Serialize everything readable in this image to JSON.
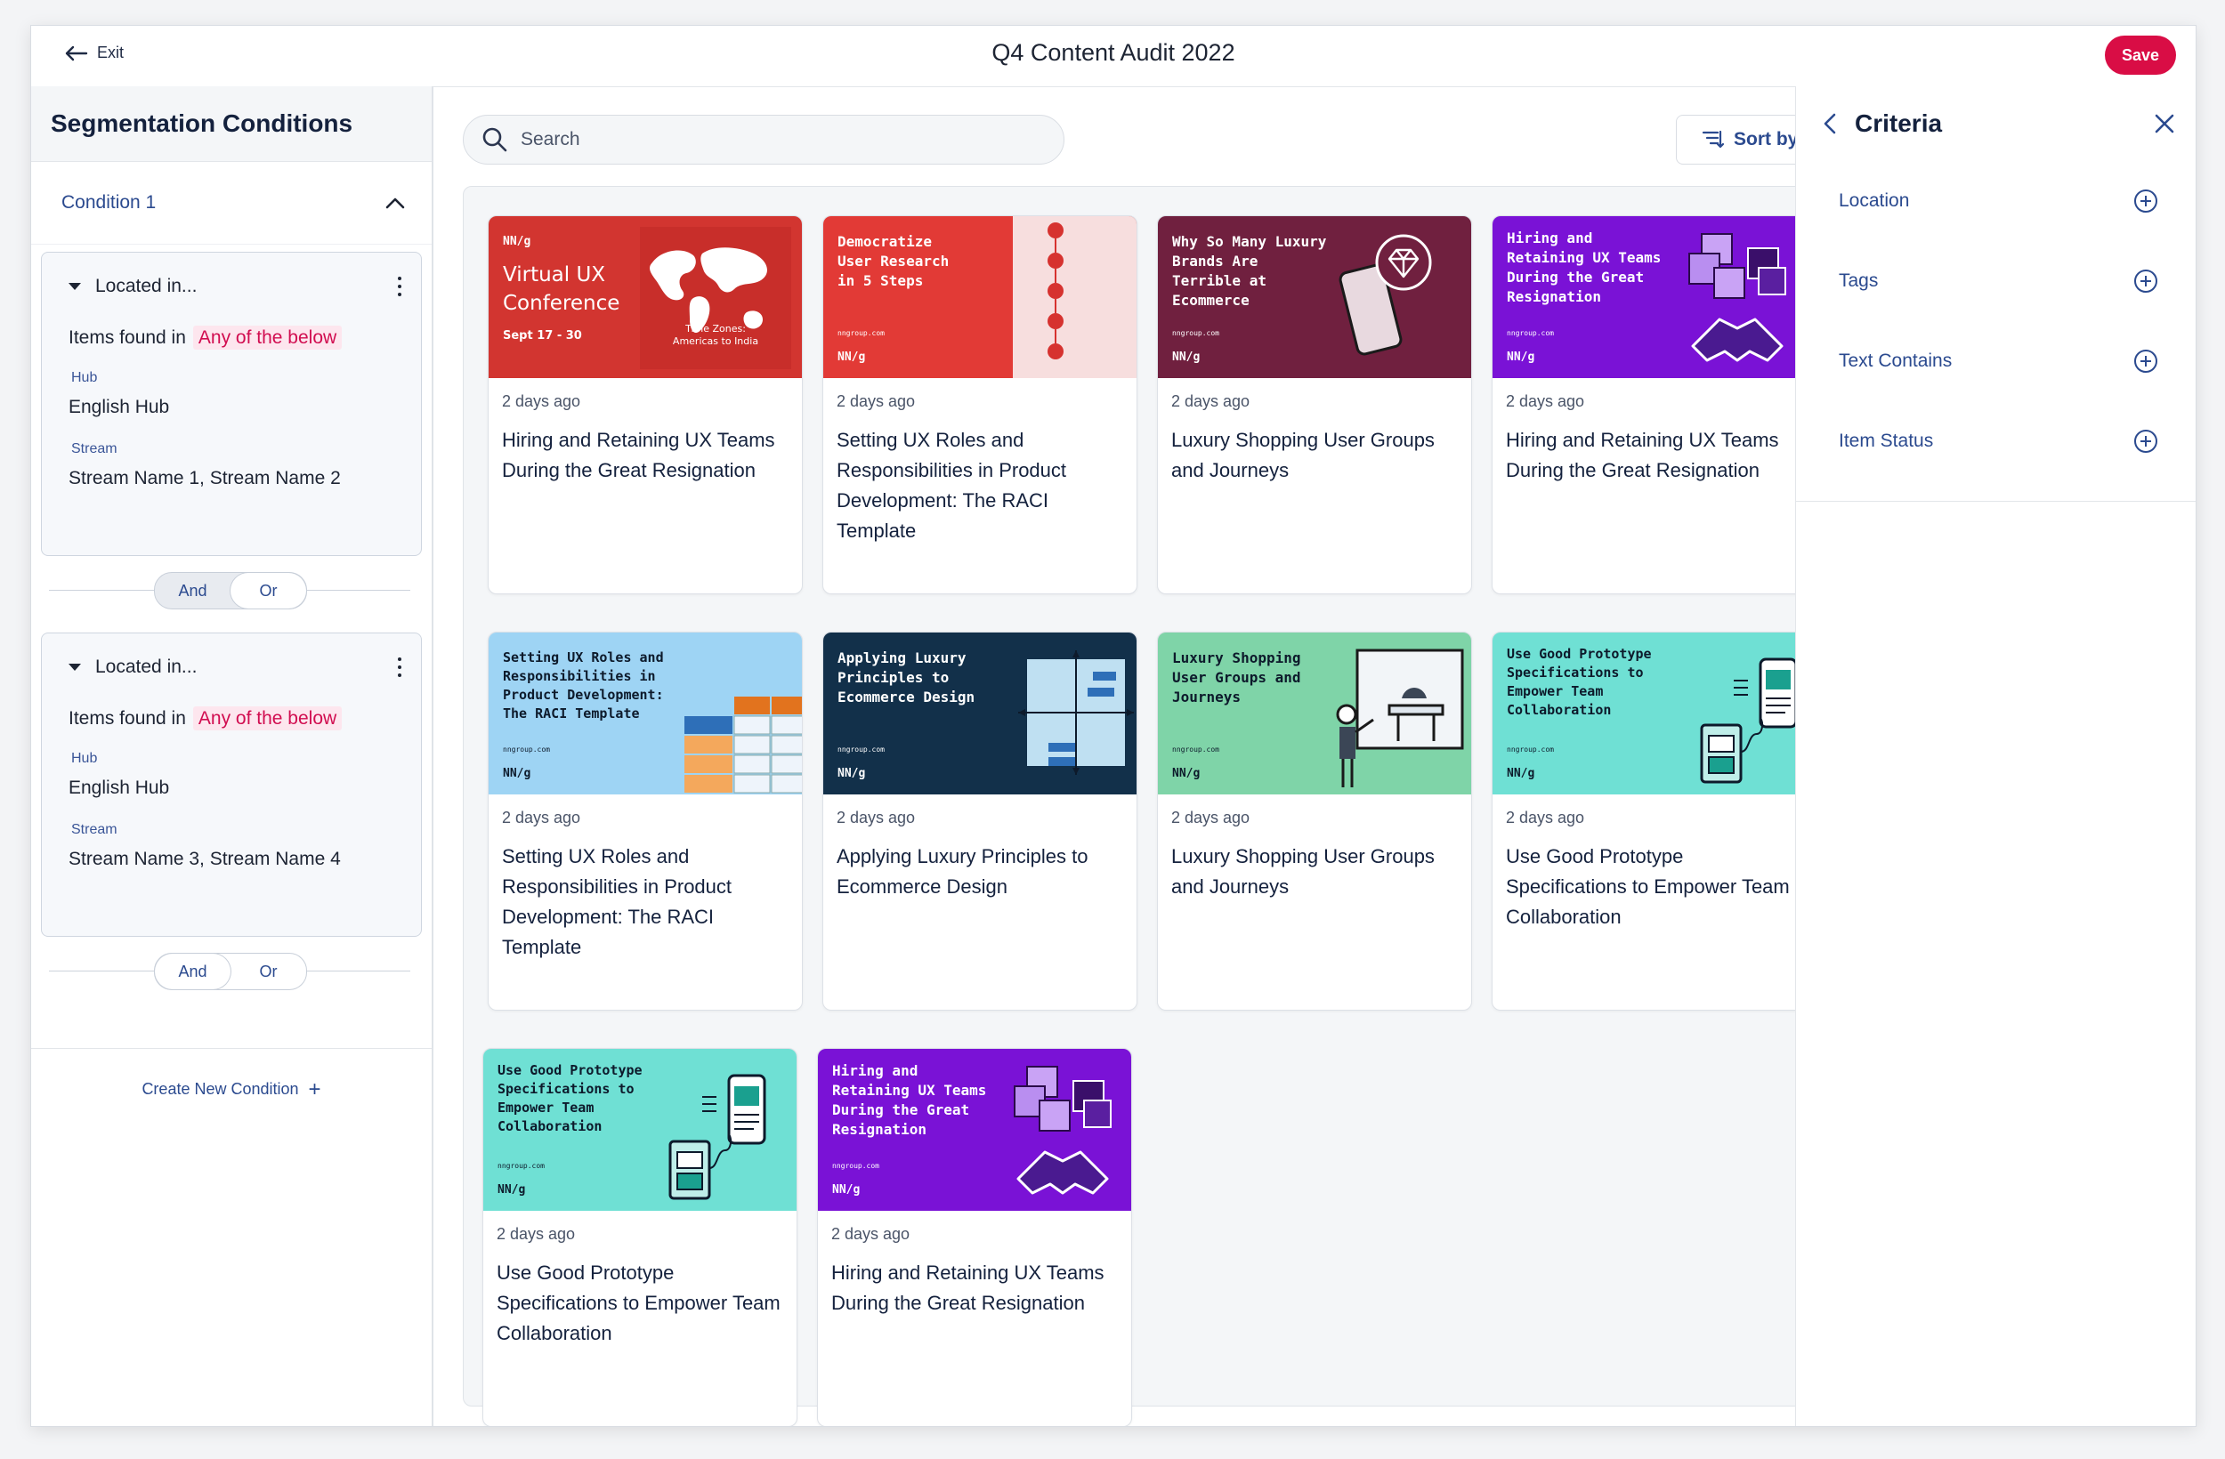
{
  "header": {
    "exit_label": "Exit",
    "title": "Q4 Content Audit 2022",
    "save_label": "Save"
  },
  "left_panel": {
    "title": "Segmentation Conditions",
    "condition_label": "Condition 1",
    "conditions": [
      {
        "type_label": "Located in...",
        "items_found": "Items found in",
        "match": "Any of the below",
        "hub_label": "Hub",
        "hub_value": "English Hub",
        "stream_label": "Stream",
        "stream_value": "Stream Name 1, Stream Name 2",
        "and_label": "And",
        "or_label": "Or",
        "selected": "Or"
      },
      {
        "type_label": "Located in...",
        "items_found": "Items found in",
        "match": "Any of the below",
        "hub_label": "Hub",
        "hub_value": "English Hub",
        "stream_label": "Stream",
        "stream_value": "Stream Name 3, Stream Name 4",
        "and_label": "And",
        "or_label": "Or",
        "selected": "And"
      }
    ],
    "create_label": "Create New Condition"
  },
  "search": {
    "placeholder": "Search"
  },
  "sort": {
    "label": "Sort by"
  },
  "cards": [
    {
      "date": "2 days ago",
      "title": "Hiring and Retaining UX Teams During the Great Resignation",
      "thumb_text": "Virtual UX Conference",
      "thumb_sub": "Sept 17 - 30",
      "thumb_extra": "Time Zones: Americas to India",
      "thumb_brand": "NN/g",
      "bg": "#d23530"
    },
    {
      "date": "2 days ago",
      "title": "Setting UX Roles and Responsibilities in Product Development: The RACI Template",
      "thumb_text": "Democratize User Research in 5 Steps",
      "thumb_brand": "NN/g",
      "thumb_site": "nngroup.com",
      "bg": "#e23a36"
    },
    {
      "date": "2 days ago",
      "title": "Luxury Shopping User Groups and Journeys",
      "thumb_text": "Why So Many Luxury Brands Are Terrible at Ecommerce",
      "thumb_brand": "NN/g",
      "thumb_site": "nngroup.com",
      "bg": "#70203f"
    },
    {
      "date": "2 days ago",
      "title": "Hiring and Retaining UX Teams During the Great Resignation",
      "thumb_text": "Hiring and Retaining UX Teams During the Great Resignation",
      "thumb_brand": "NN/g",
      "thumb_site": "nngroup.com",
      "bg": "#7a12d6"
    },
    {
      "date": "2 days ago",
      "title": "Setting UX Roles and Responsibilities in Product Development: The RACI Template",
      "thumb_text": "Setting UX Roles and Responsibilities in Product Development: The RACI Template",
      "thumb_brand": "NN/g",
      "thumb_site": "nngroup.com",
      "bg": "#9ed4f4"
    },
    {
      "date": "2 days ago",
      "title": "Applying Luxury Principles to Ecommerce Design",
      "thumb_text": "Applying Luxury Principles to Ecommerce Design",
      "thumb_brand": "NN/g",
      "thumb_site": "nngroup.com",
      "bg": "#12304a"
    },
    {
      "date": "2 days ago",
      "title": "Luxury Shopping User Groups and Journeys",
      "thumb_text": "Luxury Shopping User Groups and Journeys",
      "thumb_brand": "NN/g",
      "thumb_site": "nngroup.com",
      "bg": "#7fd4a8"
    },
    {
      "date": "2 days ago",
      "title": "Use Good Prototype Specifications to Empower Team Collaboration",
      "thumb_text": "Use Good Prototype Specifications to Empower Team Collaboration",
      "thumb_brand": "NN/g",
      "thumb_site": "nngroup.com",
      "bg": "#6fe0d4"
    },
    {
      "date": "2 days ago",
      "title": "Use Good Prototype Specifications to Empower Team Collaboration",
      "thumb_text": "Use Good Prototype Specifications to Empower Team Collaboration",
      "thumb_brand": "NN/g",
      "thumb_site": "nngroup.com",
      "bg": "#6fe0d4"
    },
    {
      "date": "2 days ago",
      "title": "Hiring and Retaining UX Teams During the Great Resignation",
      "thumb_text": "Hiring and Retaining UX Teams During the Great Resignation",
      "thumb_brand": "NN/g",
      "thumb_site": "nngroup.com",
      "bg": "#7a12d6"
    }
  ],
  "criteria": {
    "title": "Criteria",
    "items": [
      "Location",
      "Tags",
      "Text Contains",
      "Item Status"
    ]
  },
  "colors": {
    "accent": "#d90d45",
    "link": "#2b4a8f",
    "highlight_bg": "#fde6ee"
  }
}
